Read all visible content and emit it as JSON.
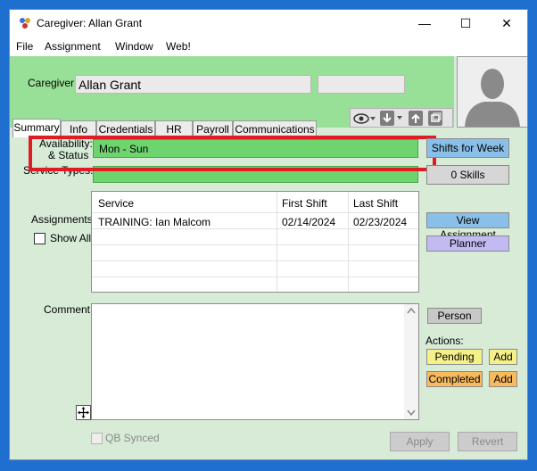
{
  "window": {
    "title": "Caregiver: Allan Grant"
  },
  "caption": {
    "minimize": "—",
    "maximize": "☐",
    "close": "✕"
  },
  "menu": [
    "File",
    "Assignment",
    "Window",
    "Web!"
  ],
  "header": {
    "caregiver_label": "Caregiver:",
    "caregiver_name": "Allan Grant"
  },
  "tabs": [
    "Summary",
    "Info",
    "Credentials",
    "HR",
    "Payroll",
    "Communications"
  ],
  "availability": {
    "label_line1": "Availability:",
    "label_line2": "& Status",
    "value": "Mon - Sun"
  },
  "service_types": {
    "label": "Service Types:"
  },
  "buttons": {
    "shifts_for_week": "Shifts for Week",
    "skills": "0 Skills",
    "view_assignment": "View Assignment",
    "planner": "Planner",
    "person": "Person",
    "pending": "Pending",
    "add1": "Add",
    "completed": "Completed",
    "add2": "Add",
    "apply": "Apply",
    "revert": "Revert"
  },
  "assignments": {
    "label": "Assignments:",
    "show_all": "Show All",
    "columns": [
      "Service",
      "First Shift",
      "Last Shift"
    ],
    "rows": [
      [
        "TRAINING: Ian Malcom",
        "02/14/2024",
        "02/23/2024"
      ]
    ]
  },
  "comment": {
    "label": "Comment:"
  },
  "actions_label": "Actions:",
  "qb_synced": "QB Synced",
  "colors": {
    "accent_green": "#6ed46e",
    "header_green": "#98e098",
    "highlight_red": "#e01b24"
  }
}
